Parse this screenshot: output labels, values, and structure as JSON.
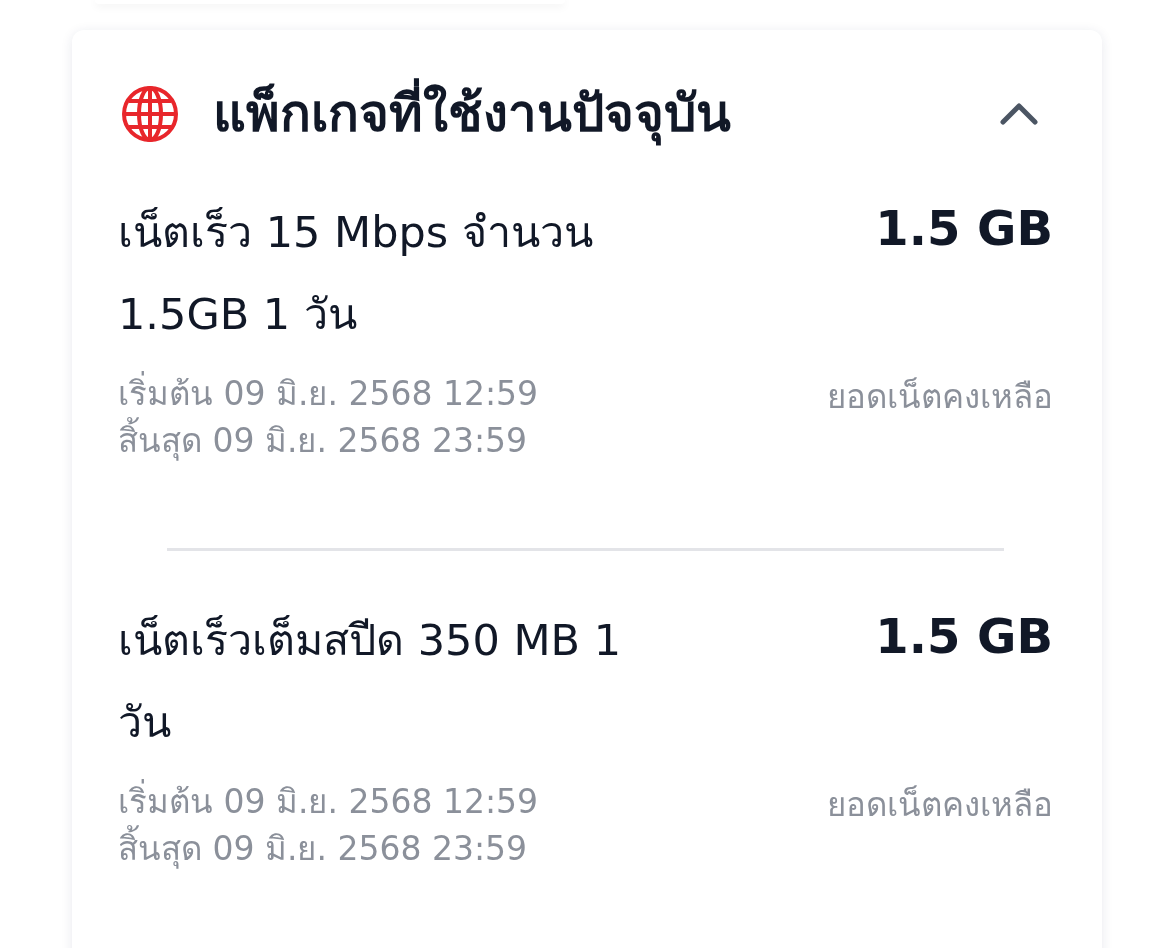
{
  "header": {
    "title": "แพ็กเกจที่ใช้งานปัจจุบัน",
    "expanded": true
  },
  "packages": [
    {
      "name": "เน็ตเร็ว 15 Mbps จำนวน 1.5GB 1 วัน",
      "amount": "1.5 GB",
      "start": "เริ่มต้น 09 มิ.ย. 2568 12:59",
      "end": "สิ้นสุด 09 มิ.ย. 2568 23:59",
      "amount_label": "ยอดเน็ตคงเหลือ"
    },
    {
      "name": "เน็ตเร็วเต็มสปีด 350 MB 1 วัน",
      "amount": "1.5 GB",
      "start": "เริ่มต้น 09 มิ.ย. 2568 12:59",
      "end": "สิ้นสุด 09 มิ.ย. 2568 23:59",
      "amount_label": "ยอดเน็ตคงเหลือ"
    }
  ]
}
